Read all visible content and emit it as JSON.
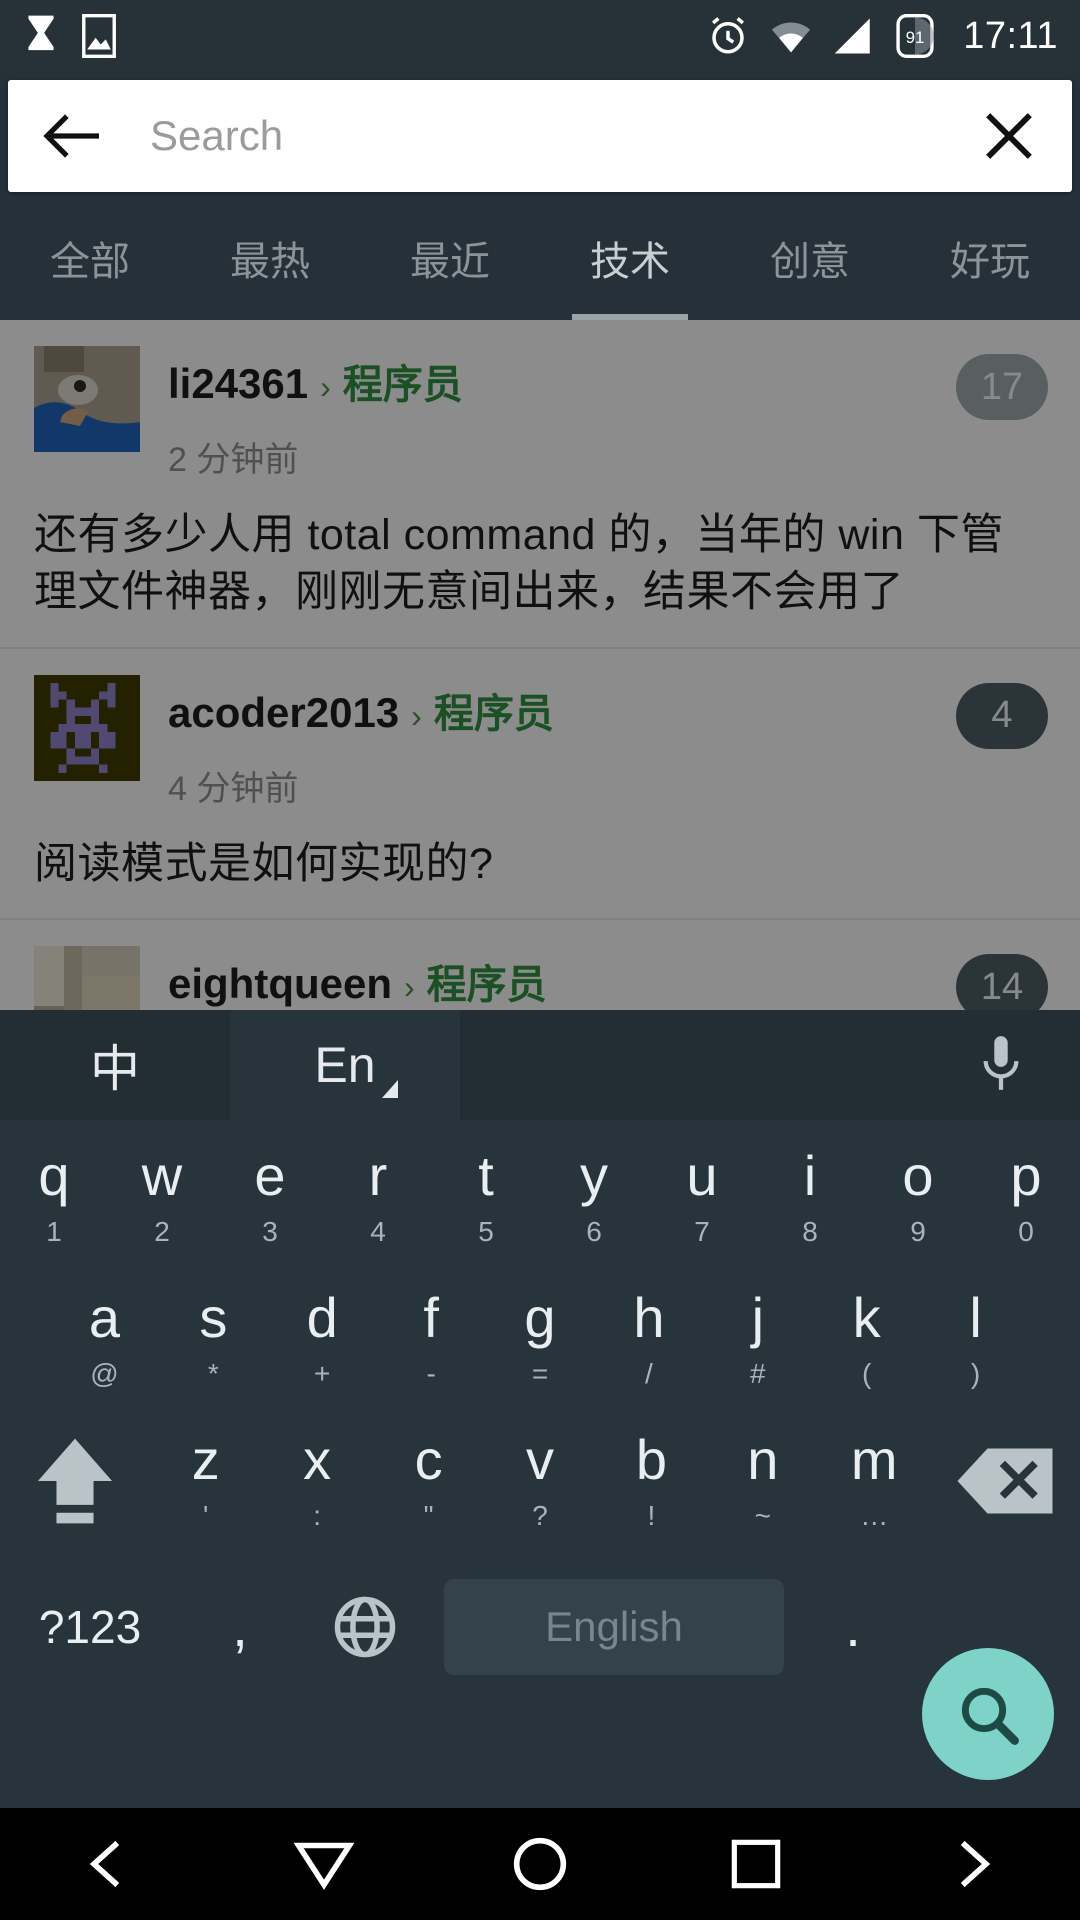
{
  "statusbar": {
    "time": "17:11",
    "battery_level": "91",
    "icons": [
      "hourglass-icon",
      "image-icon",
      "alarm-icon",
      "wifi-icon",
      "signal-icon",
      "battery-icon"
    ]
  },
  "search": {
    "placeholder": "Search",
    "value": "",
    "back_label": "back-arrow",
    "clear_label": "clear"
  },
  "tabs": [
    {
      "label": "全部",
      "active": false
    },
    {
      "label": "最热",
      "active": false
    },
    {
      "label": "最近",
      "active": false
    },
    {
      "label": "技术",
      "active": true
    },
    {
      "label": "创意",
      "active": false
    },
    {
      "label": "好玩",
      "active": false
    }
  ],
  "feed": {
    "posts": [
      {
        "username": "li24361",
        "separator": "›",
        "node": "程序员",
        "time": "2 分钟前",
        "badge": "17",
        "body": "还有多少人用 total command 的，当年的 win 下管理文件神器，刚刚无意间出来，结果不会用了"
      },
      {
        "username": "acoder2013",
        "separator": "›",
        "node": "程序员",
        "time": "4 分钟前",
        "badge": "4",
        "body": "阅读模式是如何实现的?"
      },
      {
        "username": "eightqueen",
        "separator": "›",
        "node": "程序员",
        "time": "",
        "badge": "14",
        "body": ""
      }
    ]
  },
  "keyboard": {
    "toolbar": {
      "lang_cn": "中",
      "lang_en": "En",
      "mic": "microphone"
    },
    "row1": [
      {
        "main": "q",
        "sub": "1"
      },
      {
        "main": "w",
        "sub": "2"
      },
      {
        "main": "e",
        "sub": "3"
      },
      {
        "main": "r",
        "sub": "4"
      },
      {
        "main": "t",
        "sub": "5"
      },
      {
        "main": "y",
        "sub": "6"
      },
      {
        "main": "u",
        "sub": "7"
      },
      {
        "main": "i",
        "sub": "8"
      },
      {
        "main": "o",
        "sub": "9"
      },
      {
        "main": "p",
        "sub": "0"
      }
    ],
    "row2": [
      {
        "main": "a",
        "sub": "@"
      },
      {
        "main": "s",
        "sub": "*"
      },
      {
        "main": "d",
        "sub": "+"
      },
      {
        "main": "f",
        "sub": "-"
      },
      {
        "main": "g",
        "sub": "="
      },
      {
        "main": "h",
        "sub": "/"
      },
      {
        "main": "j",
        "sub": "#"
      },
      {
        "main": "k",
        "sub": "("
      },
      {
        "main": "l",
        "sub": ")"
      }
    ],
    "row3": [
      {
        "main": "z",
        "sub": "'"
      },
      {
        "main": "x",
        "sub": ":"
      },
      {
        "main": "c",
        "sub": "\""
      },
      {
        "main": "v",
        "sub": "?"
      },
      {
        "main": "b",
        "sub": "!"
      },
      {
        "main": "n",
        "sub": "~"
      },
      {
        "main": "m",
        "sub": "…"
      }
    ],
    "row4": {
      "numeric": "?123",
      "comma": ",",
      "globe": "globe",
      "space": "English",
      "period": ".",
      "search": "search"
    }
  },
  "navbar": {
    "buttons": [
      "back-icon",
      "down-icon",
      "home-icon",
      "recents-icon",
      "forward-icon"
    ]
  },
  "colors": {
    "accent_green": "#2e8b3d",
    "chrome_dark": "#263238",
    "keyboard_bg": "#28343c",
    "fab": "#7ed2c8"
  }
}
